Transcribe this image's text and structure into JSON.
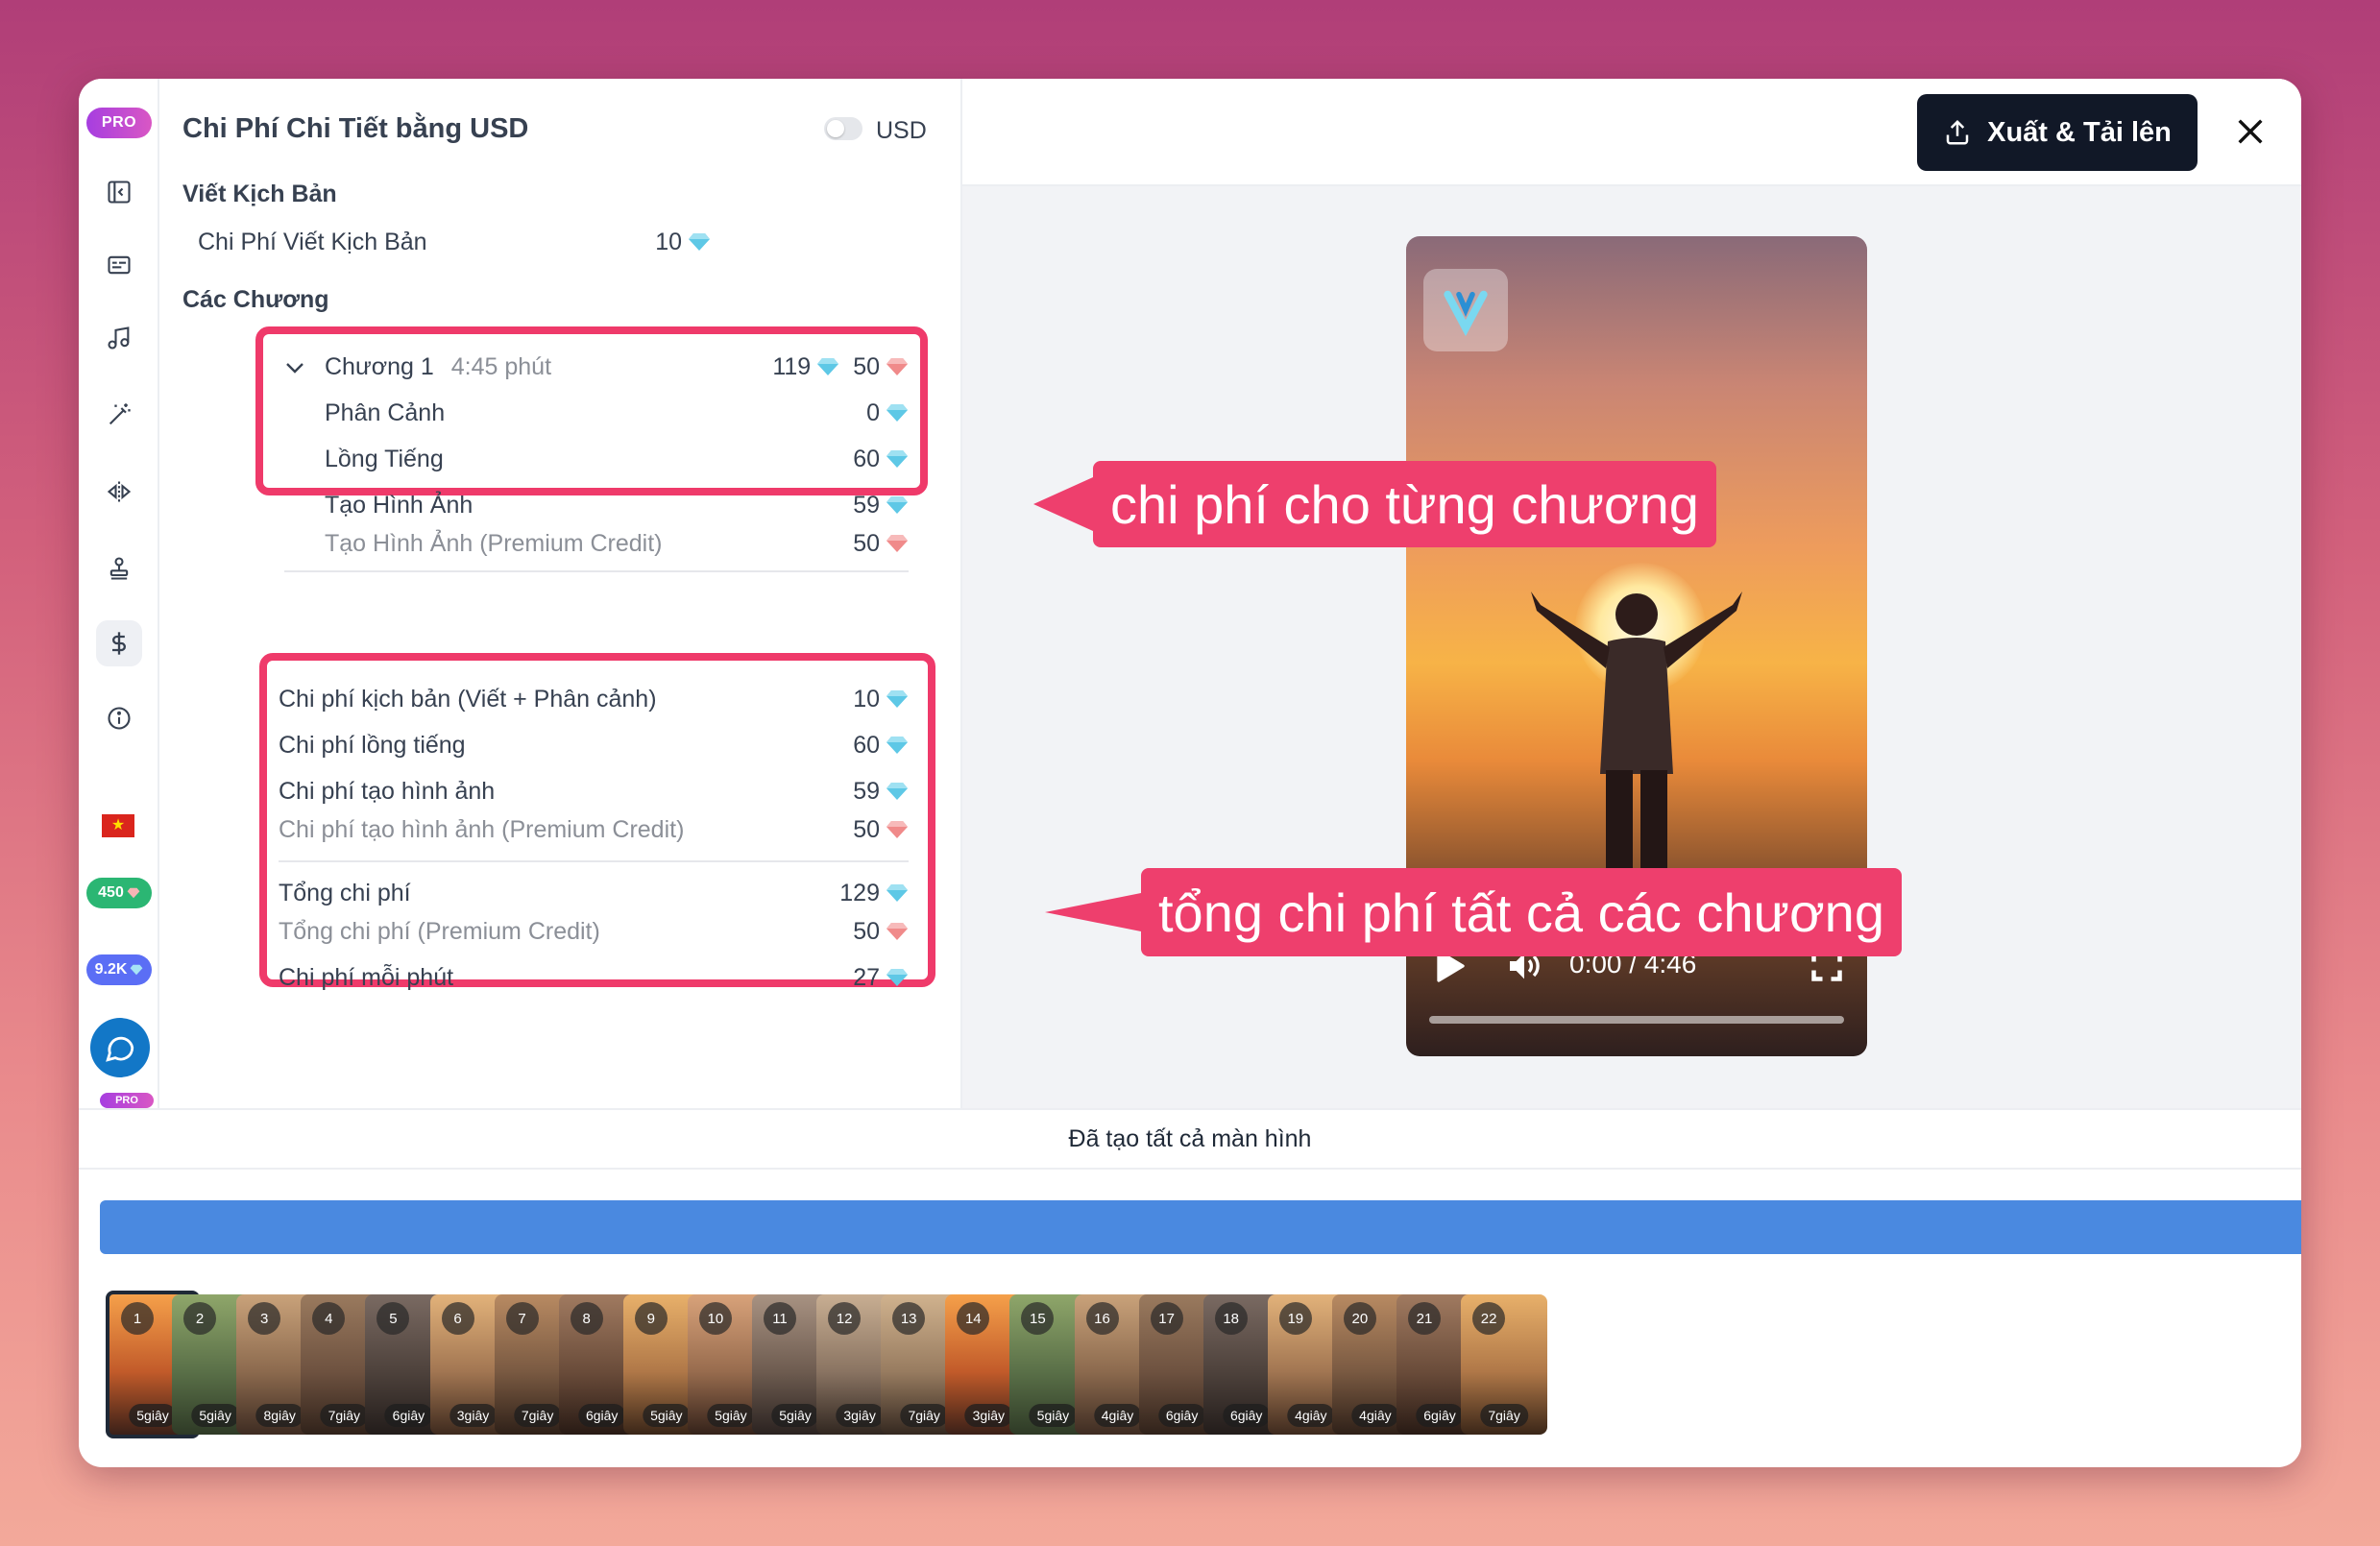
{
  "rail": {
    "pro_badge": "PRO",
    "pill_credits": "450",
    "pill_premium": "9.2K",
    "pro_mini": "PRO"
  },
  "panel": {
    "title": "Chi Phí Chi Tiết bằng USD",
    "currency_toggle_label": "USD",
    "script_section": "Viết Kịch Bản",
    "script_row": {
      "label": "Chi Phí Viết Kịch Bản",
      "value": "10"
    },
    "chapters_section": "Các Chương",
    "chapter": {
      "title": "Chương 1",
      "duration": "4:45 phút",
      "value": "119",
      "premium": "50",
      "rows": [
        {
          "label": "Phân Cảnh",
          "value": "0",
          "kind": "credit"
        },
        {
          "label": "Lồng Tiếng",
          "value": "60",
          "kind": "credit"
        },
        {
          "label": "Tạo Hình Ảnh",
          "value": "59",
          "kind": "credit"
        },
        {
          "label": "Tạo Hình Ảnh (Premium Credit)",
          "value": "50",
          "kind": "premium"
        }
      ]
    },
    "summary": [
      {
        "label": "Chi phí kịch bản (Viết + Phân cảnh)",
        "value": "10",
        "kind": "credit"
      },
      {
        "label": "Chi phí lồng tiếng",
        "value": "60",
        "kind": "credit"
      },
      {
        "label": "Chi phí tạo hình ảnh",
        "value": "59",
        "kind": "credit"
      },
      {
        "label": "Chi phí tạo hình ảnh (Premium Credit)",
        "value": "50",
        "kind": "premium"
      }
    ],
    "totals": [
      {
        "label": "Tổng chi phí",
        "value": "129",
        "kind": "credit"
      },
      {
        "label": "Tổng chi phí (Premium Credit)",
        "value": "50",
        "kind": "premium"
      },
      {
        "label": "Chi phí mỗi phút",
        "value": "27",
        "kind": "credit"
      }
    ]
  },
  "header": {
    "export_label": "Xuất & Tải lên"
  },
  "video": {
    "time": "0:00 / 4:46"
  },
  "callouts": {
    "chapter_cost": "chi phí cho từng chương",
    "total_cost": "tổng chi phí tất cả các chương"
  },
  "status": "Đã tạo tất cả màn hình",
  "thumbnails": [
    {
      "n": "1",
      "dur": "5giây"
    },
    {
      "n": "2",
      "dur": "5giây"
    },
    {
      "n": "3",
      "dur": "8giây"
    },
    {
      "n": "4",
      "dur": "7giây"
    },
    {
      "n": "5",
      "dur": "6giây"
    },
    {
      "n": "6",
      "dur": "3giây"
    },
    {
      "n": "7",
      "dur": "7giây"
    },
    {
      "n": "8",
      "dur": "6giây"
    },
    {
      "n": "9",
      "dur": "5giây"
    },
    {
      "n": "10",
      "dur": "5giây"
    },
    {
      "n": "11",
      "dur": "5giây"
    },
    {
      "n": "12",
      "dur": "3giây"
    },
    {
      "n": "13",
      "dur": "7giây"
    },
    {
      "n": "14",
      "dur": "3giây"
    },
    {
      "n": "15",
      "dur": "5giây"
    },
    {
      "n": "16",
      "dur": "4giây"
    },
    {
      "n": "17",
      "dur": "6giây"
    },
    {
      "n": "18",
      "dur": "6giây"
    },
    {
      "n": "19",
      "dur": "4giây"
    },
    {
      "n": "20",
      "dur": "4giây"
    },
    {
      "n": "21",
      "dur": "6giây"
    },
    {
      "n": "22",
      "dur": "7giây"
    }
  ],
  "colors": {
    "accent": "#ef3a6a",
    "timeline": "#4a89e0",
    "credit_gem": "#5ec8e6",
    "premium_gem": "#f08a8a"
  }
}
